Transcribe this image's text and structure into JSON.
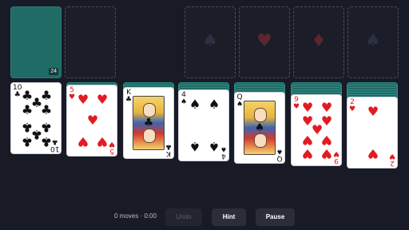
{
  "stock": {
    "count": "24"
  },
  "foundations": [
    {
      "suit": "♠",
      "color": "black"
    },
    {
      "suit": "♥",
      "color": "red"
    },
    {
      "suit": "♦",
      "color": "red"
    },
    {
      "suit": "♠",
      "color": "black"
    }
  ],
  "tableau": [
    {
      "hidden": 0,
      "rank": "10",
      "suit": "♣",
      "color": "black"
    },
    {
      "hidden": 1,
      "rank": "5",
      "suit": "♥",
      "color": "red"
    },
    {
      "hidden": 2,
      "rank": "K",
      "suit": "♣",
      "color": "black"
    },
    {
      "hidden": 3,
      "rank": "4",
      "suit": "♠",
      "color": "black"
    },
    {
      "hidden": 4,
      "rank": "Q",
      "suit": "♠",
      "color": "black"
    },
    {
      "hidden": 5,
      "rank": "9",
      "suit": "♥",
      "color": "red"
    },
    {
      "hidden": 6,
      "rank": "2",
      "suit": "♥",
      "color": "red"
    }
  ],
  "status": {
    "text": "0 moves · 0:00"
  },
  "buttons": {
    "undo": "Undo",
    "hint": "Hint",
    "pause": "Pause"
  },
  "colors": {
    "background": "#181a26",
    "card_back": "#1f6b66",
    "red_suit": "#e21b23",
    "black_suit": "#111111"
  }
}
